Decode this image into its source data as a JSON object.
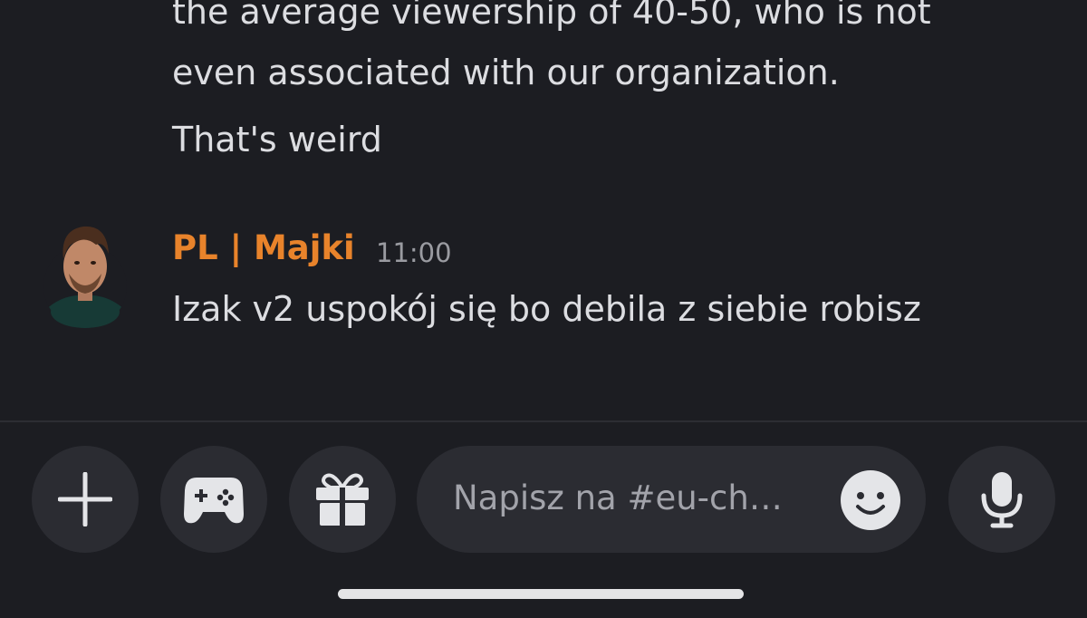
{
  "messages": {
    "previous": [
      "the average viewership of 40-50, who is not",
      "even associated with our organization.",
      "That's weird"
    ],
    "latest": {
      "author": "PL | Majki",
      "time": "11:00",
      "text": "Izak v2 uspokój się bo debila z siebie robisz"
    }
  },
  "composer": {
    "placeholder": "Napisz na #eu-ch…",
    "icons": [
      "plus-icon",
      "gamepad-icon",
      "gift-icon",
      "emoji-icon",
      "microphone-icon"
    ]
  },
  "colors": {
    "background": "#1c1d22",
    "author": "#e8832b",
    "button": "#2b2c32"
  }
}
